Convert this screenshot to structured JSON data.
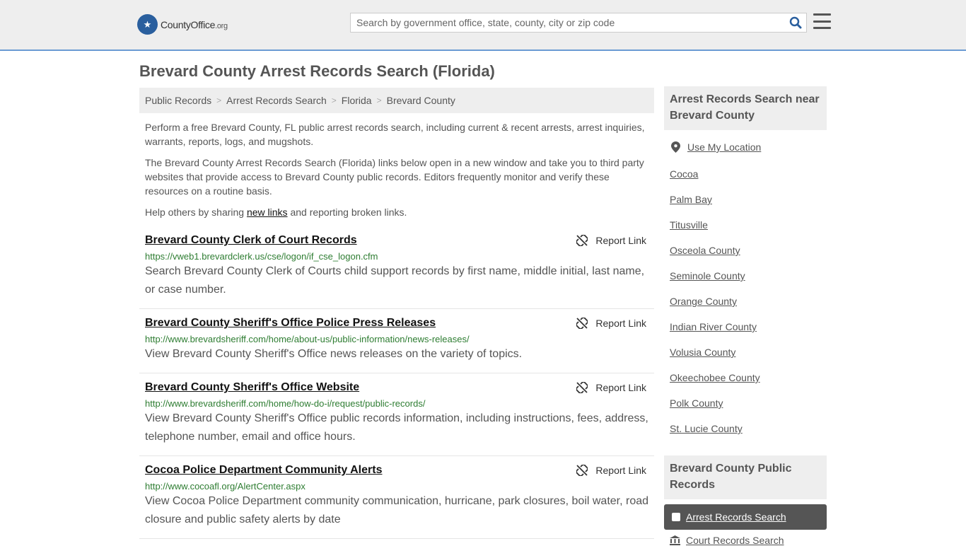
{
  "header": {
    "logo_text": "CountyOffice",
    "logo_suffix": ".org",
    "search_placeholder": "Search by government office, state, county, city or zip code"
  },
  "page_title": "Brevard County Arrest Records Search (Florida)",
  "breadcrumb": [
    "Public Records",
    "Arrest Records Search",
    "Florida",
    "Brevard County"
  ],
  "intro": {
    "p1": "Perform a free Brevard County, FL public arrest records search, including current & recent arrests, arrest inquiries, warrants, reports, logs, and mugshots.",
    "p2": "The Brevard County Arrest Records Search (Florida) links below open in a new window and take you to third party websites that provide access to Brevard County public records. Editors frequently monitor and verify these resources on a routine basis.",
    "p3_before": "Help others by sharing ",
    "p3_link": "new links",
    "p3_after": " and reporting broken links."
  },
  "report_label": "Report Link",
  "results": [
    {
      "title": "Brevard County Clerk of Court Records",
      "url": "https://vweb1.brevardclerk.us/cse/logon/if_cse_logon.cfm",
      "desc": "Search Brevard County Clerk of Courts child support records by first name, middle initial, last name, or case number."
    },
    {
      "title": "Brevard County Sheriff's Office Police Press Releases",
      "url": "http://www.brevardsheriff.com/home/about-us/public-information/news-releases/",
      "desc": "View Brevard County Sheriff's Office news releases on the variety of topics."
    },
    {
      "title": "Brevard County Sheriff's Office Website",
      "url": "http://www.brevardsheriff.com/home/how-do-i/request/public-records/",
      "desc": "View Brevard County Sheriff's Office public records information, including instructions, fees, address, telephone number, email and office hours."
    },
    {
      "title": "Cocoa Police Department Community Alerts",
      "url": "http://www.cocoafl.org/AlertCenter.aspx",
      "desc": "View Cocoa Police Department community communication, hurricane, park closures, boil water, road closure and public safety alerts by date"
    }
  ],
  "sidebar": {
    "nearby_title": "Arrest Records Search near Brevard County",
    "use_location": "Use My Location",
    "nearby": [
      "Cocoa",
      "Palm Bay",
      "Titusville",
      "Osceola County",
      "Seminole County",
      "Orange County",
      "Indian River County",
      "Volusia County",
      "Okeechobee County",
      "Polk County",
      "St. Lucie County"
    ],
    "public_records_title": "Brevard County Public Records",
    "active_item": "Arrest Records Search",
    "next_item": "Court Records Search"
  },
  "colors": {
    "header_bg": "#eeeeee",
    "header_border": "#6b9bd3",
    "url_green": "#2e7d32",
    "search_icon": "#2a5f9e",
    "active_bg": "#555555"
  }
}
